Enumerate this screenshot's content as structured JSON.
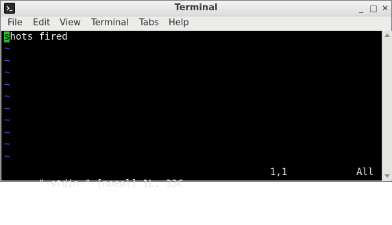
{
  "window": {
    "title": "Terminal",
    "minimize_glyph": "_",
    "maximize_glyph": "□",
    "close_glyph": "✕"
  },
  "menubar": {
    "items": [
      "File",
      "Edit",
      "View",
      "Terminal",
      "Tabs",
      "Help"
    ]
  },
  "terminal": {
    "cursor_char": "s",
    "first_line_rest": "hots fired",
    "tilde": "~",
    "status_left": "\"-stdin-\" [noeol] 1L, 33C",
    "status_position": "1,1",
    "status_scroll": "All",
    "colors": {
      "background": "#000000",
      "foreground": "#e6e6e6",
      "cursor": "#25c02a",
      "tilde": "#5b5bff"
    }
  },
  "icons": {
    "app": "terminal-app-icon",
    "minimize": "minimize-icon",
    "maximize": "maximize-icon",
    "close": "close-icon"
  }
}
